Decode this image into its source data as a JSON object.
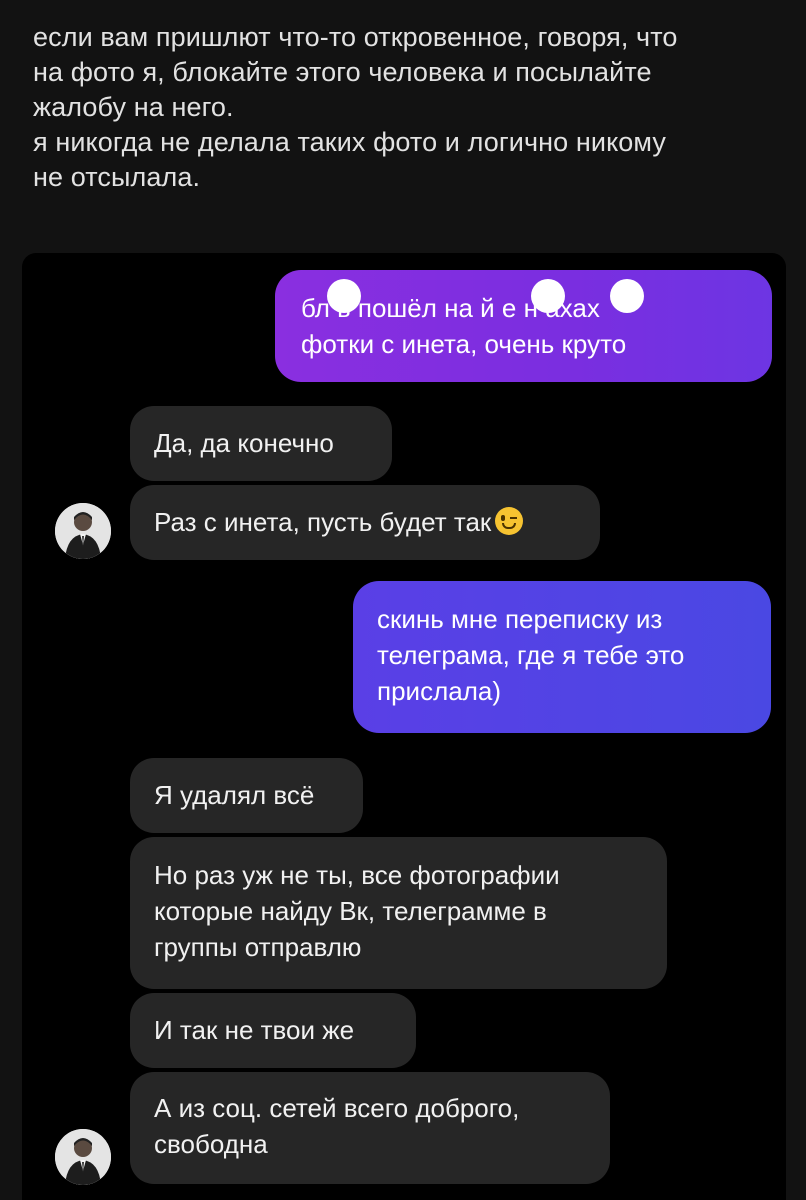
{
  "post": {
    "lines": [
      "если вам пришлют что-то откровенное, говоря, что",
      "на фото я, блокайте этого человека и посылайте",
      "жалобу на него.",
      "я никогда не делала таких фото и логично никому",
      "не отсылала."
    ]
  },
  "chat": {
    "messages": [
      {
        "direction": "outgoing",
        "lines": [
          "бл  ь пошёл на  й е   н ахах",
          "фотки с инета, очень круто"
        ]
      },
      {
        "direction": "incoming",
        "lines": [
          "Да, да конечно"
        ]
      },
      {
        "direction": "incoming",
        "lines": [
          "Раз с инета, пусть будет так"
        ],
        "emoji": "winking-face"
      },
      {
        "direction": "outgoing",
        "lines": [
          "скинь мне переписку из",
          "телеграма, где я тебе это",
          "прислала)"
        ]
      },
      {
        "direction": "incoming",
        "lines": [
          "Я удалял всё"
        ]
      },
      {
        "direction": "incoming",
        "lines": [
          "Но раз уж не ты, все фотографии",
          "которые найду Вк, телеграмме в",
          "группы отправлю"
        ]
      },
      {
        "direction": "incoming",
        "lines": [
          "И так не твои же"
        ]
      },
      {
        "direction": "incoming",
        "lines": [
          "А из соц. сетей всего доброго,",
          "свободна"
        ]
      }
    ],
    "colors": {
      "outgoing_purple": "#8a2fe0",
      "outgoing_blue": "#4a48e3",
      "incoming_bg": "#262626",
      "screen_bg": "#000000"
    },
    "avatar_icon": "person-in-suit-avatar",
    "censor_marks": "white-blot-censor"
  }
}
